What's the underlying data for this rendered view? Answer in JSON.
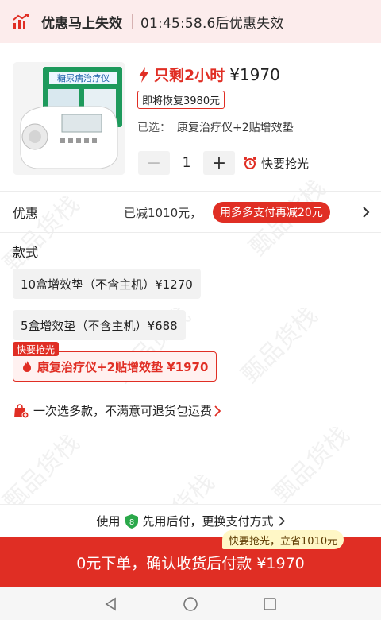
{
  "topbar": {
    "title": "优惠马上失效",
    "countdown": "01:45:58.6后优惠失效",
    "icon": "chart-icon"
  },
  "product": {
    "image_caption": "糖尿病治疗仪",
    "remain_label": "只剩2小时",
    "price": "¥1970",
    "restore_tag": "即将恢复3980元",
    "selected_label": "已选：",
    "selected_value": "康复治疗仪+2贴增效垫",
    "quantity": "1",
    "hot_label": "快要抢光"
  },
  "promo": {
    "label": "优惠",
    "saved": "已减1010元，",
    "pill": "用多多支付再减20元"
  },
  "options": {
    "title": "款式",
    "items": [
      {
        "label": "10盒增效垫（不含主机）¥1270"
      },
      {
        "label": "5盒增效垫（不含主机）¥688"
      },
      {
        "label": "康复治疗仪+2贴增效垫 ¥1970"
      }
    ],
    "selected_badge": "快要抢光"
  },
  "multi_select": {
    "text": "一次选多款，不满意可退货包运费"
  },
  "payment": {
    "prefix": "使用",
    "text": "先用后付，更换支付方式"
  },
  "cta": {
    "tag": "快要抢光，立省1010元",
    "label": "0元下单，确认收货后付款 ¥1970"
  },
  "watermark": "甄品货栈",
  "colors": {
    "accent": "#e02e24",
    "topbar_bg": "#fcecec",
    "cta_tag_bg": "#fff7c6",
    "shield_green": "#2aa84a"
  }
}
